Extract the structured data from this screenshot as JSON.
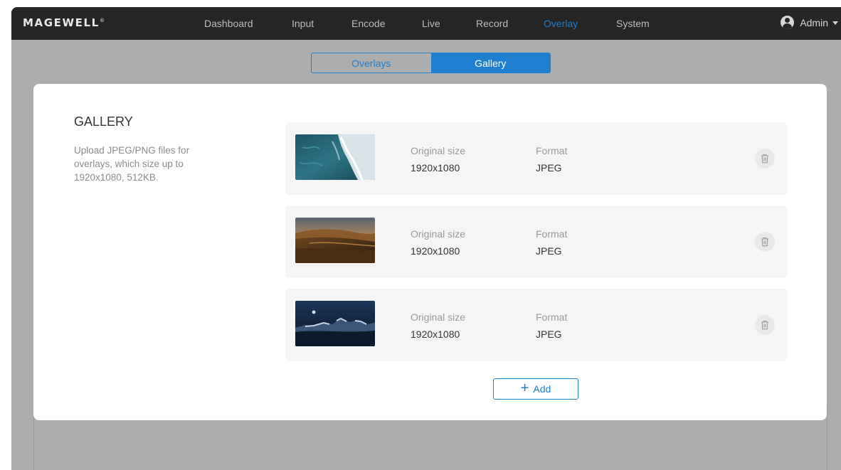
{
  "topbar": {
    "brand": "MAGEWELL",
    "brand_mark": "®",
    "nav": [
      "Dashboard",
      "Input",
      "Encode",
      "Live",
      "Record",
      "Overlay",
      "System"
    ],
    "active_nav": "Overlay",
    "user_name": "Admin",
    "user_icon": "user-avatar-icon",
    "user_menu_icon": "caret-down-icon"
  },
  "tabs": {
    "items": [
      "Overlays",
      "Gallery"
    ],
    "active": "Gallery"
  },
  "gallery": {
    "title": "GALLERY",
    "description": "Upload JPEG/PNG files for overlays, which size up to 1920x1080, 512KB.",
    "size_label": "Original size",
    "format_label": "Format",
    "delete_icon": "trash-icon",
    "items": [
      {
        "thumbnail": "ocean-waves-thumbnail",
        "size": "1920x1080",
        "format": "JPEG"
      },
      {
        "thumbnail": "desert-dunes-thumbnail",
        "size": "1920x1080",
        "format": "JPEG"
      },
      {
        "thumbnail": "night-mountains-thumbnail",
        "size": "1920x1080",
        "format": "JPEG"
      }
    ],
    "add_icon": "plus-icon",
    "add_label": "Add"
  },
  "colors": {
    "accent": "#1e7ed0",
    "topbar_bg": "#262626",
    "backdrop": "#adadad",
    "card_bg": "#ffffff",
    "item_bg": "#f5f5f5"
  }
}
